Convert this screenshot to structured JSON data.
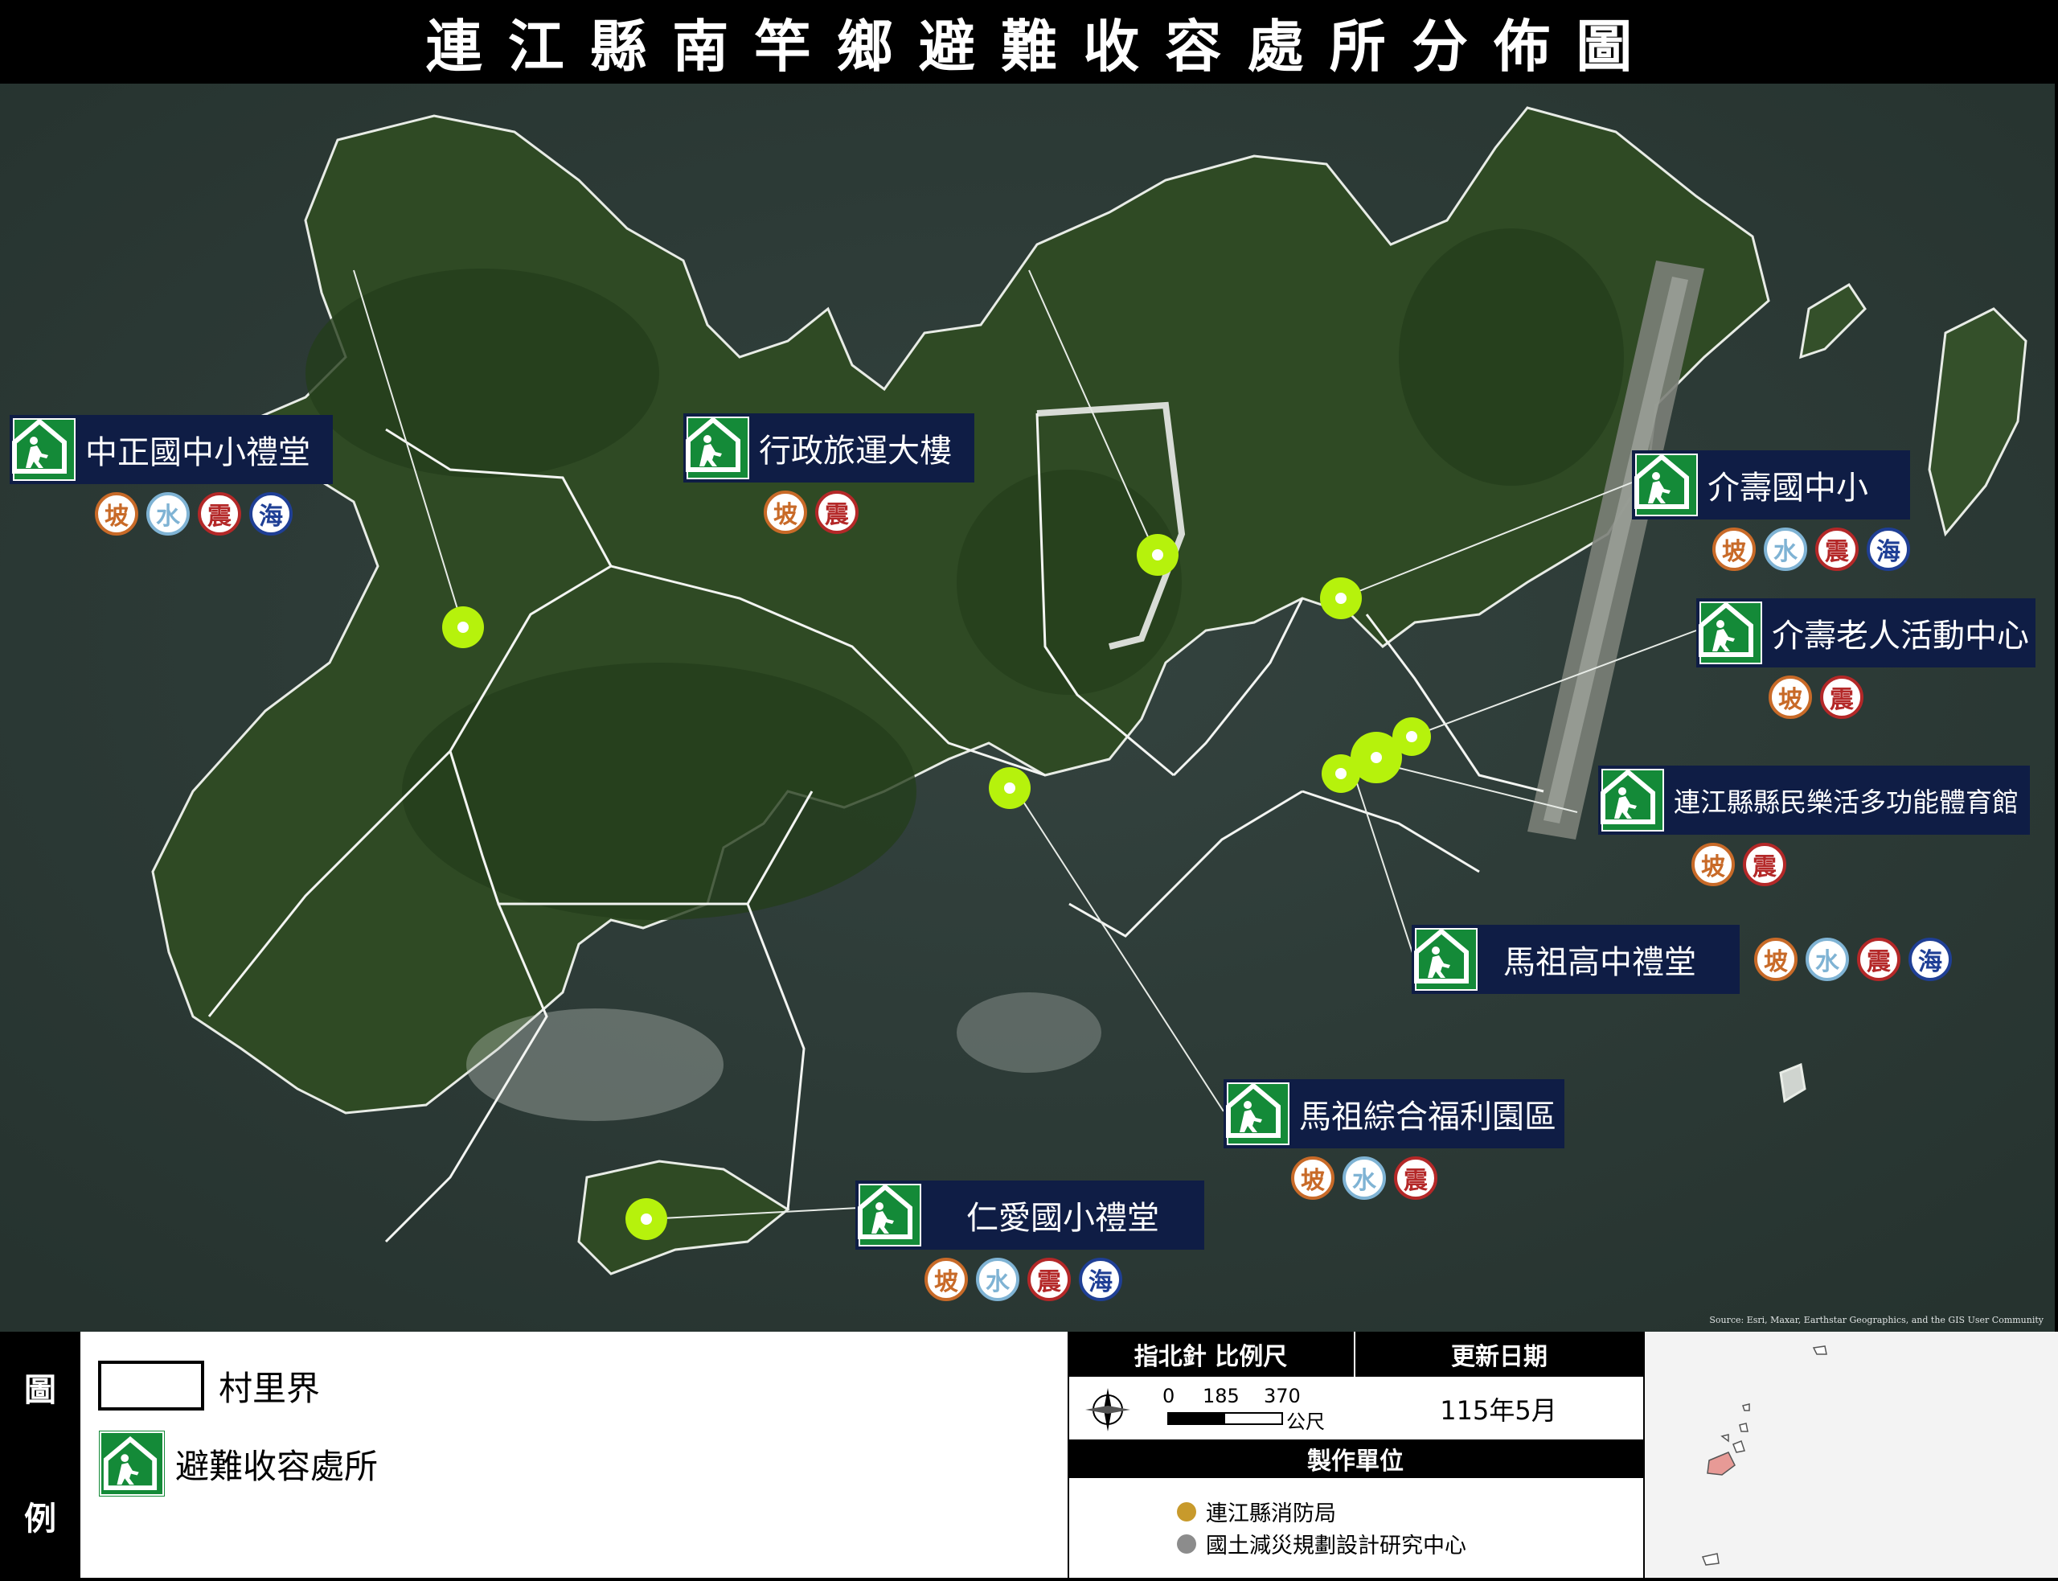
{
  "title": "連江縣南竿鄉避難收容處所分佈圖",
  "attribution": "Source: Esri, Maxar, Earthstar Geographics, and the GIS User Community",
  "hazards": {
    "slope": "坡",
    "flood": "水",
    "quake": "震",
    "sea": "海"
  },
  "colors": {
    "marker": "#b6f20c",
    "shelter_green": "#148a38",
    "label_navy": "#0f1d45",
    "sea": "#2b3b39",
    "land": "#2d4a22"
  },
  "shelters": [
    {
      "name": "中正國中小禮堂",
      "hazards": [
        "坡",
        "水",
        "震",
        "海"
      ]
    },
    {
      "name": "行政旅運大樓",
      "hazards": [
        "坡",
        "震"
      ]
    },
    {
      "name": "介壽國中小",
      "hazards": [
        "坡",
        "水",
        "震",
        "海"
      ]
    },
    {
      "name": "介壽老人活動中心",
      "hazards": [
        "坡",
        "震"
      ]
    },
    {
      "name": "連江縣縣民樂活多功能體育館",
      "hazards": [
        "坡",
        "震"
      ]
    },
    {
      "name": "馬祖高中禮堂",
      "hazards": [
        "坡",
        "水",
        "震",
        "海"
      ]
    },
    {
      "name": "馬祖綜合福利園區",
      "hazards": [
        "坡",
        "水",
        "震"
      ]
    },
    {
      "name": "仁愛國小禮堂",
      "hazards": [
        "坡",
        "水",
        "震",
        "海"
      ]
    }
  ],
  "legend": {
    "side_top": "圖",
    "side_bottom": "例",
    "items": [
      {
        "label": "村里界"
      },
      {
        "label": "避難收容處所"
      }
    ]
  },
  "info": {
    "compass_scale_header": "指北針 比例尺",
    "scale_ticks": [
      "0",
      "185",
      "370"
    ],
    "scale_unit": "公尺",
    "update_header": "更新日期",
    "update_date": "115年5月",
    "producer_header": "製作單位",
    "producers": [
      "連江縣消防局",
      "國土減災規劃設計研究中心"
    ]
  }
}
